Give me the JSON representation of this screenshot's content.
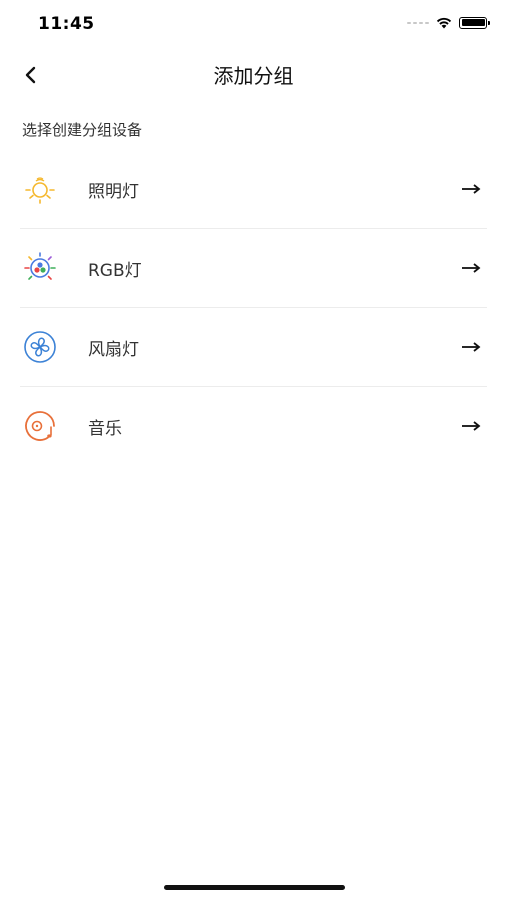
{
  "status_bar": {
    "time": "11:45"
  },
  "nav": {
    "title": "添加分组"
  },
  "section": {
    "label": "选择创建分组设备"
  },
  "devices": [
    {
      "label": "照明灯",
      "icon": "lightbulb-icon",
      "color": "#F5B82E"
    },
    {
      "label": "RGB灯",
      "icon": "rgb-light-icon",
      "color": "#4A7BE0"
    },
    {
      "label": "风扇灯",
      "icon": "fan-icon",
      "color": "#3C82D6"
    },
    {
      "label": "音乐",
      "icon": "music-icon",
      "color": "#E8703A"
    }
  ]
}
